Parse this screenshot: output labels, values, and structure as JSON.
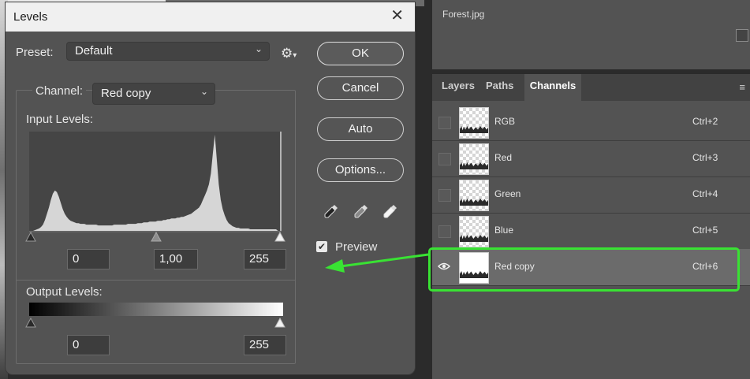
{
  "dialog": {
    "title": "Levels",
    "preset_label": "Preset:",
    "preset_value": "Default",
    "channel_label": "Channel:",
    "channel_value": "Red copy",
    "input_levels_label": "Input Levels:",
    "input_levels": {
      "black": "0",
      "gamma": "1,00",
      "white": "255"
    },
    "output_levels_label": "Output Levels:",
    "output_levels": {
      "black": "0",
      "white": "255"
    },
    "buttons": {
      "ok": "OK",
      "cancel": "Cancel",
      "auto": "Auto",
      "options": "Options..."
    },
    "preview_label": "Preview",
    "preview_checked": true,
    "close_glyph": "✕"
  },
  "histogram": {
    "description_values": [
      0,
      0,
      0,
      1,
      2,
      3,
      5,
      8,
      14,
      22,
      30,
      40,
      48,
      52,
      50,
      44,
      36,
      28,
      22,
      18,
      15,
      13,
      12,
      11,
      10,
      10,
      9,
      9,
      9,
      8,
      8,
      8,
      8,
      8,
      8,
      7,
      7,
      7,
      7,
      7,
      7,
      7,
      7,
      8,
      8,
      8,
      8,
      8,
      8,
      8,
      9,
      9,
      9,
      9,
      9,
      10,
      10,
      10,
      11,
      11,
      11,
      12,
      12,
      12,
      12,
      13,
      13,
      13,
      14,
      14,
      15,
      15,
      16,
      16,
      16,
      17,
      17,
      18,
      18,
      19,
      20,
      21,
      22,
      24,
      26,
      28,
      30,
      34,
      40,
      46,
      52,
      60,
      74,
      100,
      124,
      92,
      60,
      40,
      28,
      20,
      14,
      10,
      8,
      6,
      5,
      4,
      4,
      3,
      3,
      3,
      3,
      3,
      2,
      2,
      2,
      2,
      2,
      2,
      2,
      2,
      2,
      2,
      2,
      2,
      2,
      2,
      0,
      0
    ]
  },
  "right_panel": {
    "file_name": "Forest.jpg",
    "tabs": [
      "Layers",
      "Paths",
      "Channels"
    ],
    "active_tab": "Channels",
    "channels": [
      {
        "name": "RGB",
        "shortcut": "Ctrl+2"
      },
      {
        "name": "Red",
        "shortcut": "Ctrl+3"
      },
      {
        "name": "Green",
        "shortcut": "Ctrl+4"
      },
      {
        "name": "Blue",
        "shortcut": "Ctrl+5"
      },
      {
        "name": "Red copy",
        "shortcut": "Ctrl+6"
      }
    ],
    "selected_channel": "Red copy"
  },
  "colors": {
    "highlight": "#39e233",
    "panel": "#535353",
    "dialog_title_bg": "#f0f0f0"
  }
}
